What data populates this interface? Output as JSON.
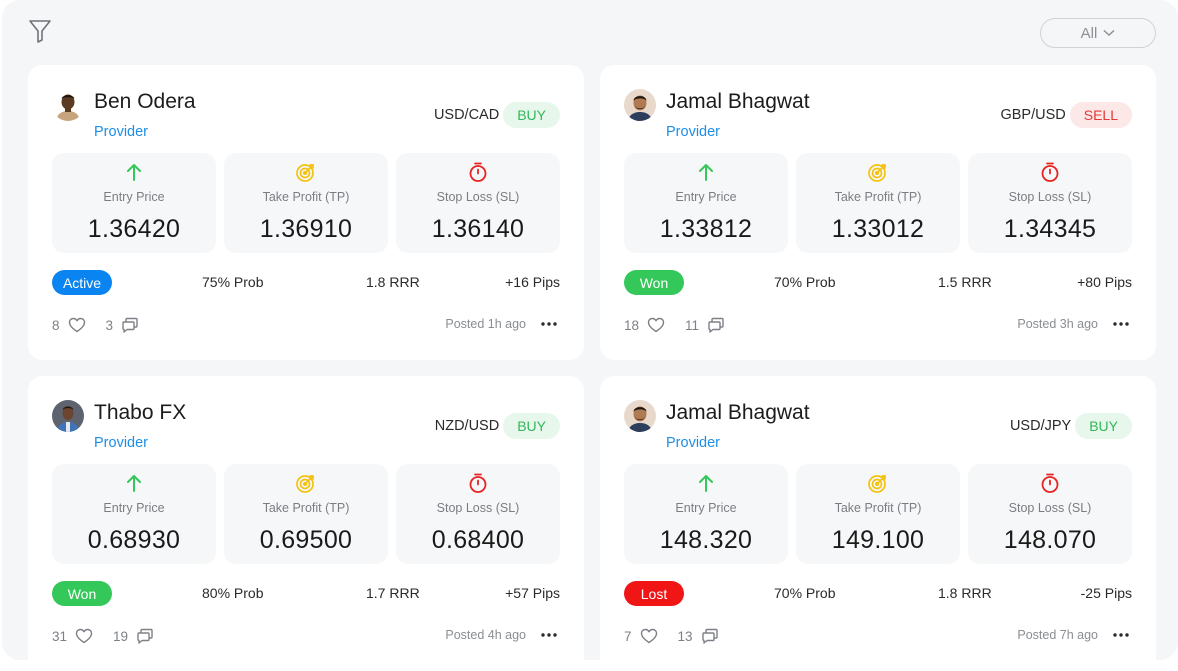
{
  "filter": {
    "dropdown_label": "All"
  },
  "labels": {
    "entry": "Entry Price",
    "tp": "Take Profit (TP)",
    "sl": "Stop Loss (SL)"
  },
  "colors": {
    "accent_blue": "#0a84f0",
    "won_green": "#34c759",
    "lost_red": "#f01616",
    "buy_green": "#34b75a",
    "sell_red": "#e23838",
    "tp_yellow": "#f4c20d"
  },
  "cards": [
    {
      "name": "Ben Odera",
      "role": "Provider",
      "pair": "USD/CAD",
      "side": "BUY",
      "entry": "1.36420",
      "tp": "1.36910",
      "sl": "1.36140",
      "status": "Active",
      "prob": "75% Prob",
      "rrr": "1.8 RRR",
      "pips": "+16 Pips",
      "likes": "8",
      "comments": "3",
      "posted": "Posted 1h ago"
    },
    {
      "name": "Jamal Bhagwat",
      "role": "Provider",
      "pair": "GBP/USD",
      "side": "SELL",
      "entry": "1.33812",
      "tp": "1.33012",
      "sl": "1.34345",
      "status": "Won",
      "prob": "70% Prob",
      "rrr": "1.5 RRR",
      "pips": "+80 Pips",
      "likes": "18",
      "comments": "11",
      "posted": "Posted 3h ago"
    },
    {
      "name": "Thabo FX",
      "role": "Provider",
      "pair": "NZD/USD",
      "side": "BUY",
      "entry": "0.68930",
      "tp": "0.69500",
      "sl": "0.68400",
      "status": "Won",
      "prob": "80% Prob",
      "rrr": "1.7 RRR",
      "pips": "+57 Pips",
      "likes": "31",
      "comments": "19",
      "posted": "Posted 4h ago"
    },
    {
      "name": "Jamal Bhagwat",
      "role": "Provider",
      "pair": "USD/JPY",
      "side": "BUY",
      "entry": "148.320",
      "tp": "149.100",
      "sl": "148.070",
      "status": "Lost",
      "prob": "70% Prob",
      "rrr": "1.8 RRR",
      "pips": "-25 Pips",
      "likes": "7",
      "comments": "13",
      "posted": "Posted 7h ago"
    }
  ]
}
